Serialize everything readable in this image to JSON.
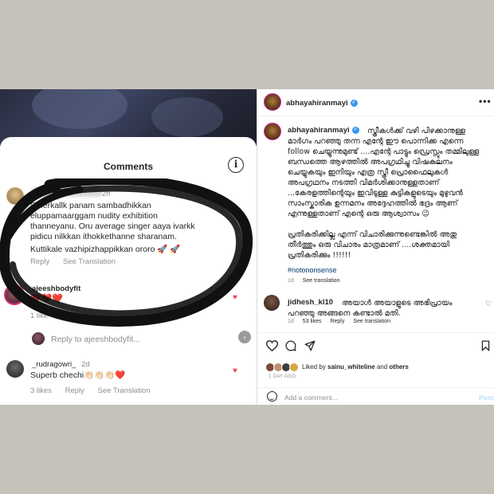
{
  "left_panel": {
    "title": "Comments",
    "comments": [
      {
        "time": "2h",
        "text_lines": [
          "Stherkallk panam sambadhikkan",
          "eluppamaarggam nudity exhibition",
          "thanneyanu. Oru average singer aaya ivarkk",
          "pidicu nilkkan ithokkethanne sharanam.",
          "Kuttikale vazhipizhappikkan ororo 🚀 🚀"
        ],
        "reply": "Reply",
        "translate": "See Translation"
      },
      {
        "username": "ajeeshbodyfit",
        "text": "❤️❤️❤️",
        "likes": "1 like",
        "reply": "Reply"
      },
      {
        "reply_to": "Reply to ajeeshbodyfit..."
      },
      {
        "username": "_rudragowri_",
        "time": "2d",
        "text": "Superb chechi👏🏻👏🏻👏🏻❤️",
        "likes": "3 likes",
        "reply": "Reply",
        "translate": "See Translation"
      }
    ]
  },
  "right_panel": {
    "header_username": "abhayahiranmayi",
    "caption_username": "abhayahiranmayi",
    "caption_paragraphs": [
      "സ്ത്രീകൾക്ക് വഴി പിഴക്കാനുള്ള മാർഗം പറഞ്ഞു തന്ന എന്റേ ഈ പൊന്നിക്ക എന്നെ follow ചെയ്യുന്നുമുണ്ട് ....എന്റേ പാട്ടും ഡ്രെസ്സും തമ്മിലുള്ള ബന്ധത്തെ ആഴത്തിൽ അപഗ്രഥിച്ചു വിഷകലനം ചെയ്യുകയും ഇനിയും എത്ര സ്ത്രീ പ്രൊഫൈലുകൾ അപഗ്രഥനം നടത്തി വിമർശിക്കാനുള്ളതാണ് ...കേരളത്തിന്റെയും ഇവിടുള്ള കുട്ടികളുടെയും മുഴുവൻ സാംസ്കാരിക ഉന്നമനം അദ്ദേഹത്തിൽ ഭദ്രം ആണ് എന്നുള്ളതാണ് എന്റെ ഒരു ആശ്വാസം 😉",
      "പ്രതികരിക്കില്ല എന്ന് വിചാരിക്കുന്നുണ്ടെങ്കിൽ അതു തീർത്തും ഒരു വിചാരം മാത്രമാണ് ....ശക്തമായി പ്രതികരിക്കും !!!!!!"
    ],
    "hashtag": "#notononsense",
    "caption_time": "1d",
    "caption_translate": "See translation",
    "comment": {
      "username": "jidhesh_kl10",
      "text": "അയാൾ അയാളുടെ അഭിപ്രായം പറഞ്ഞു അങ്ങനെ കണ്ടാൽ മതി.",
      "time": "1d",
      "likes": "53 likes",
      "reply": "Reply",
      "translate": "See translation"
    },
    "liked_by_prefix": "Liked by ",
    "liked_by_user": "sainu_whiteline",
    "liked_by_suffix": " and ",
    "liked_by_others": "others",
    "posted_ago": "1 DAY AGO",
    "add_comment_placeholder": "Add a comment...",
    "post_label": "Post",
    "icons": [
      "more-icon",
      "heart-outline-icon",
      "comment-icon",
      "share-icon",
      "bookmark-icon",
      "emoji-icon",
      "verified-icon"
    ]
  },
  "colors": {
    "band": "#c5c2b9",
    "link": "#00376b",
    "heart": "#ed4956",
    "verified": "#3897f0",
    "muted": "#8e8e8e"
  }
}
